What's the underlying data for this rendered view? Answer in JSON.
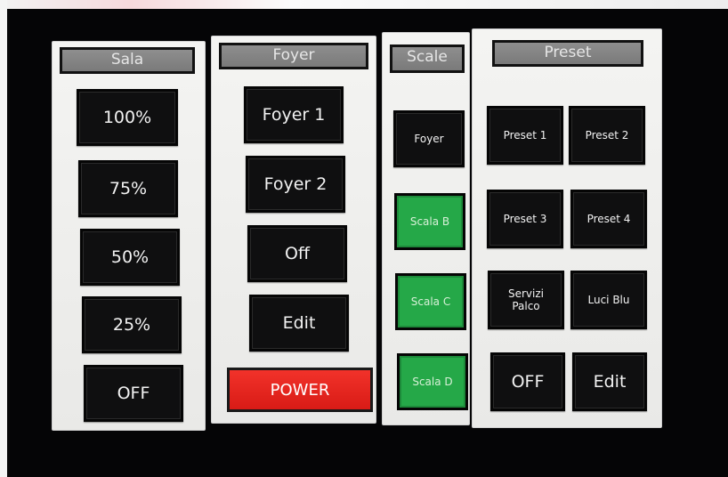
{
  "sala": {
    "title": "Sala",
    "buttons": [
      "100%",
      "75%",
      "50%",
      "25%",
      "OFF"
    ]
  },
  "foyer": {
    "title": "Foyer",
    "buttons": [
      "Foyer 1",
      "Foyer 2",
      "Off",
      "Edit"
    ],
    "power_label": "POWER"
  },
  "scale": {
    "title": "Scale",
    "buttons": [
      "Foyer",
      "Scala B",
      "Scala C",
      "Scala D"
    ]
  },
  "preset": {
    "title": "Preset",
    "buttons": [
      "Preset 1",
      "Preset 2",
      "Preset 3",
      "Preset 4",
      "Servizi\nPalco",
      "Luci Blu"
    ],
    "off_label": "OFF",
    "edit_label": "Edit"
  },
  "colors": {
    "active_green": "#25a848",
    "power_red": "#e52620",
    "header_gray": "#858585"
  }
}
